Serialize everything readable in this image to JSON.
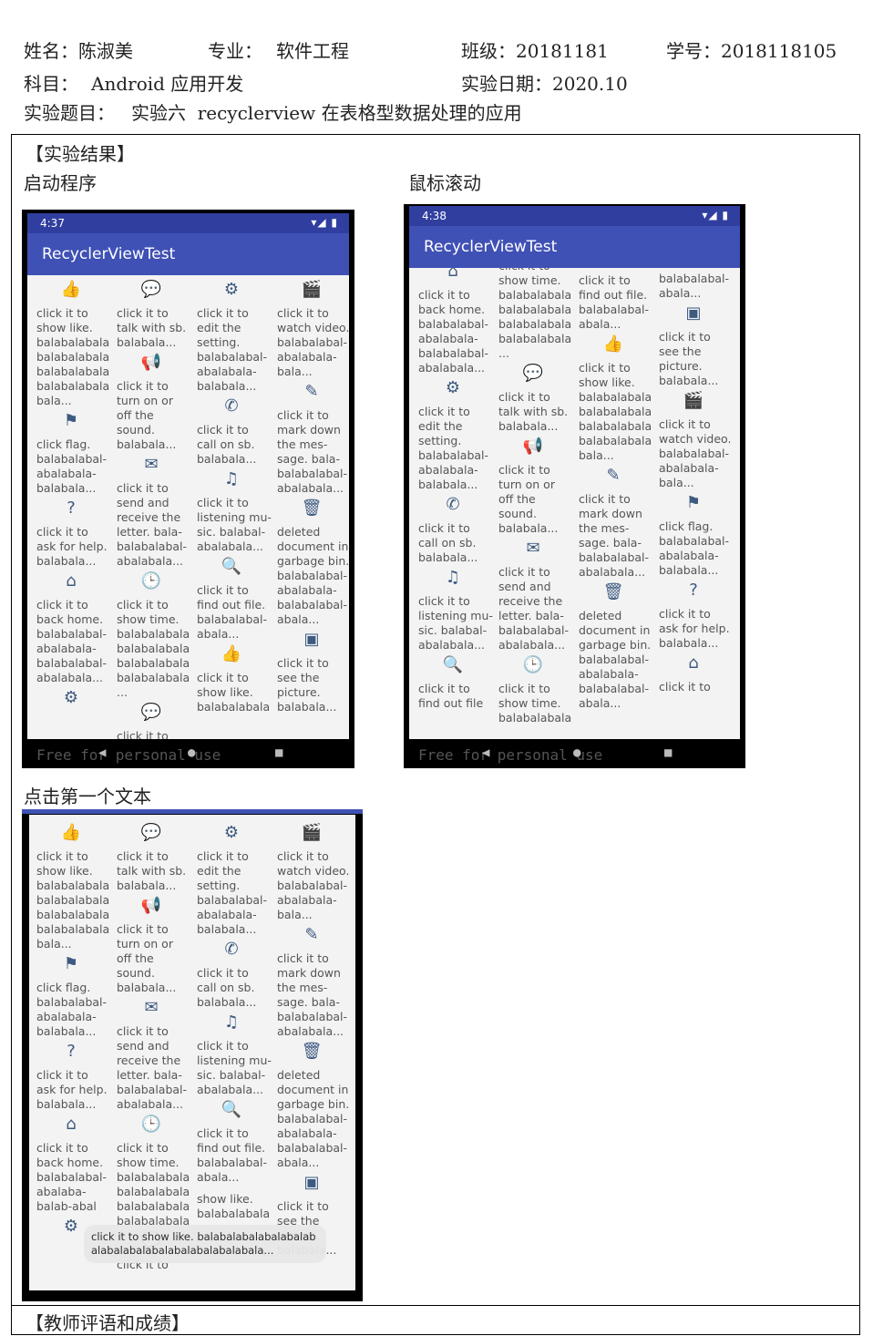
{
  "header": {
    "name_label": "姓名：陈淑美",
    "major_label": "专业：",
    "major_value": "软件工程",
    "class_label": "班级：20181181",
    "id_label": "学号：2018118105",
    "subject_label": "科目：",
    "subject_value": "Android 应用开发",
    "date_label": "实验日期：2020.10",
    "topic_label": "实验题目：",
    "topic_value": "实验六  recyclerview 在表格型数据处理的应用"
  },
  "sections": {
    "result_title": "【实验结果】",
    "start_label": "启动程序",
    "scroll_label": "鼠标滚动",
    "click_label": "点击第一个文本",
    "teacher_title": "【教师评语和成绩】"
  },
  "phone1": {
    "time": "4:37",
    "status_icons": "▾◢ ▮",
    "app_title": "RecyclerViewTest",
    "watermark": "Free for personal use",
    "nav": [
      "◀",
      "●",
      "■"
    ],
    "columns": [
      [
        {
          "icon": "👍",
          "text": "click it to show like. balabalabala balabalabala balabalabala balabalabala bala..."
        },
        {
          "icon": "⚑",
          "text": "click flag. balabalabal-abalabala-balabala..."
        },
        {
          "icon": "?",
          "text": "click it to ask for help. balabala..."
        },
        {
          "icon": "⌂",
          "text": "click it to back home. balabalabal-abalabala-balabalabal-abalabala..."
        },
        {
          "icon": "⚙",
          "text": ""
        }
      ],
      [
        {
          "icon": "💬",
          "text": "click it to talk with sb. balabala..."
        },
        {
          "icon": "📢",
          "text": "click it to turn on or off the sound. balabala..."
        },
        {
          "icon": "✉",
          "text": "click it to send and receive the letter. bala-balabalabal-abalabala..."
        },
        {
          "icon": "🕒",
          "text": "click it to show time. balabalabala balabalabala balabalabala balabalabala ..."
        },
        {
          "icon": "💬",
          "text": "click it to"
        }
      ],
      [
        {
          "icon": "⚙",
          "text": "click it to edit the setting. balabalabal-abalabala-balabala..."
        },
        {
          "icon": "✆",
          "text": "click it to call on sb. balabala..."
        },
        {
          "icon": "♫",
          "text": "click it to listening mu-sic. balabal-abalabala..."
        },
        {
          "icon": "🔍",
          "text": "click it to find out file. balabalabal-abala..."
        },
        {
          "icon": "👍",
          "text": "click it to show like. balabalabala"
        }
      ],
      [
        {
          "icon": "🎬",
          "text": "click it to watch video. balabalabal-abalabala-bala..."
        },
        {
          "icon": "✎",
          "text": "click it to mark down the mes-sage. bala-balabalabal-abalabala..."
        },
        {
          "icon": "🗑",
          "text": "deleted document in garbage bin. balabalabal-abalabala-balabalabal-abala..."
        },
        {
          "icon": "▣",
          "text": "click it to see the picture. balabala..."
        }
      ]
    ]
  },
  "phone2": {
    "time": "4:38",
    "status_icons": "▾◢ ▮",
    "app_title": "RecyclerViewTest",
    "watermark": "Free for personal use",
    "nav": [
      "◀",
      "●",
      "■"
    ],
    "columns": [
      [
        {
          "icon": "⌂",
          "text": "click it to back home. balabalabal-abalabala-balabalabal-abalabala..."
        },
        {
          "icon": "⚙",
          "text": "click it to edit the setting. balabalabal-abalabala-balabala..."
        },
        {
          "icon": "✆",
          "text": "click it to call on sb. balabala..."
        },
        {
          "icon": "♫",
          "text": "click it to listening mu-sic. balabal-abalabala..."
        },
        {
          "icon": "🔍",
          "text": "click it to find out file"
        }
      ],
      [
        {
          "icon": "",
          "text": "click it to show time. balabalabala balabalabala balabalabala balabalabala ..."
        },
        {
          "icon": "💬",
          "text": "click it to talk with sb. balabala..."
        },
        {
          "icon": "📢",
          "text": "click it to turn on or off the sound. balabala..."
        },
        {
          "icon": "✉",
          "text": "click it to send and receive the letter. bala-balabalabal-abalabala..."
        },
        {
          "icon": "🕒",
          "text": "click it to show time. balabalabala"
        }
      ],
      [
        {
          "icon": "",
          "text": "click it to find out file. balabalabal-abala..."
        },
        {
          "icon": "👍",
          "text": "click it to show like. balabalabala balabalabala balabalabala balabalabala bala..."
        },
        {
          "icon": "✎",
          "text": "click it to mark down the mes-sage. bala-balabalabal-abalabala..."
        },
        {
          "icon": "🗑",
          "text": "deleted document in garbage bin. balabalabal-abalabala-balabalabal-abala..."
        }
      ],
      [
        {
          "icon": "",
          "text": "abalabala-balabalabal-abala..."
        },
        {
          "icon": "▣",
          "text": "click it to see the picture. balabala..."
        },
        {
          "icon": "🎬",
          "text": "click it to watch video. balabalabal-abalabala-bala..."
        },
        {
          "icon": "⚑",
          "text": "click flag. balabalabal-abalabala-balabala..."
        },
        {
          "icon": "?",
          "text": "click it to ask for help. balabala..."
        },
        {
          "icon": "⌂",
          "text": "click it to"
        }
      ]
    ]
  },
  "phone3": {
    "toast": "click it to show like. balabalabalabalabalab alabalabalabalabalabalabalabala...",
    "columns": [
      [
        {
          "icon": "👍",
          "text": "click it to show like. balabalabala balabalabala balabalabala balabalabala bala..."
        },
        {
          "icon": "⚑",
          "text": "click flag. balabalabal-abalabala-balabala..."
        },
        {
          "icon": "?",
          "text": "click it to ask for help. balabala..."
        },
        {
          "icon": "⌂",
          "text": "click it to back home. balabalabal-abalaba-balab-abal"
        },
        {
          "icon": "⚙",
          "text": ""
        }
      ],
      [
        {
          "icon": "💬",
          "text": "click it to talk with sb. balabala..."
        },
        {
          "icon": "📢",
          "text": "click it to turn on or off the sound. balabala..."
        },
        {
          "icon": "✉",
          "text": "click it to send and receive the letter. bala-balabalabal-abalabala..."
        },
        {
          "icon": "🕒",
          "text": "click it to show time. balabalabala balabalabala balabalabala balabalabala"
        },
        {
          "icon": "💬",
          "text": "click it to"
        }
      ],
      [
        {
          "icon": "⚙",
          "text": "click it to edit the setting. balabalabal-abalabala-balabala..."
        },
        {
          "icon": "✆",
          "text": "click it to call on sb. balabala..."
        },
        {
          "icon": "♫",
          "text": "click it to listening mu-sic. balabal-abalabala..."
        },
        {
          "icon": "🔍",
          "text": "click it to find out file. balabalabal-abala..."
        },
        {
          "icon": "",
          "text": "show like. balabalabala"
        }
      ],
      [
        {
          "icon": "🎬",
          "text": "click it to watch video. balabalabal-abalabala-bala..."
        },
        {
          "icon": "✎",
          "text": "click it to mark down the mes-sage. bala-balabalabal-abalabala..."
        },
        {
          "icon": "🗑",
          "text": "deleted document in garbage bin. balabalabal-abalabala-balabalabal-abala..."
        },
        {
          "icon": "▣",
          "text": "click it to see the picture. balabala..."
        }
      ]
    ]
  }
}
